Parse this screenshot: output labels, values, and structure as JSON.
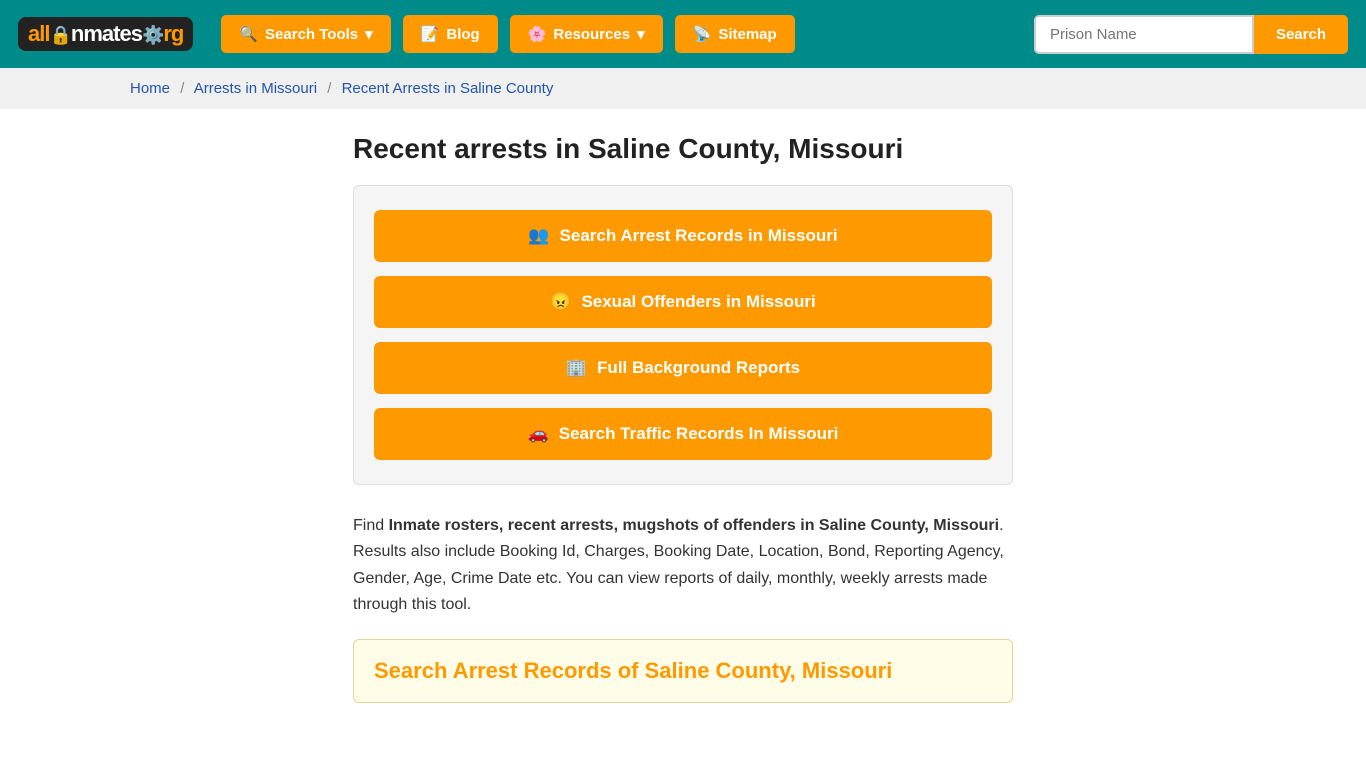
{
  "header": {
    "logo": {
      "all": "all",
      "inmates": "Inmates",
      "org": ".org"
    },
    "nav": [
      {
        "id": "search-tools",
        "label": "Search Tools",
        "icon": "🔍",
        "hasDropdown": true
      },
      {
        "id": "blog",
        "label": "Blog",
        "icon": "📝",
        "hasDropdown": false
      },
      {
        "id": "resources",
        "label": "Resources",
        "icon": "🌸",
        "hasDropdown": true
      },
      {
        "id": "sitemap",
        "label": "Sitemap",
        "icon": "📡",
        "hasDropdown": false
      }
    ],
    "search": {
      "placeholder": "Prison Name",
      "button_label": "Search"
    }
  },
  "breadcrumb": {
    "home": "Home",
    "arrests": "Arrests in Missouri",
    "current": "Recent Arrests in Saline County"
  },
  "page": {
    "title": "Recent arrests in Saline County, Missouri",
    "action_buttons": [
      {
        "id": "search-arrest",
        "icon": "👥",
        "label": "Search Arrest Records in Missouri"
      },
      {
        "id": "sexual-offenders",
        "icon": "😠",
        "label": "Sexual Offenders in Missouri"
      },
      {
        "id": "background-reports",
        "icon": "🏢",
        "label": "Full Background Reports"
      },
      {
        "id": "traffic-records",
        "icon": "🚗",
        "label": "Search Traffic Records In Missouri"
      }
    ],
    "description_prefix": "Find ",
    "description_bold": "Inmate rosters, recent arrests, mugshots of offenders in Saline County, Missouri",
    "description_suffix": ". Results also include Booking Id, Charges, Booking Date, Location, Bond, Reporting Agency, Gender, Age, Crime Date etc. You can view reports of daily, monthly, weekly arrests made through this tool.",
    "search_section_title": "Search Arrest Records of Saline County, Missouri"
  }
}
